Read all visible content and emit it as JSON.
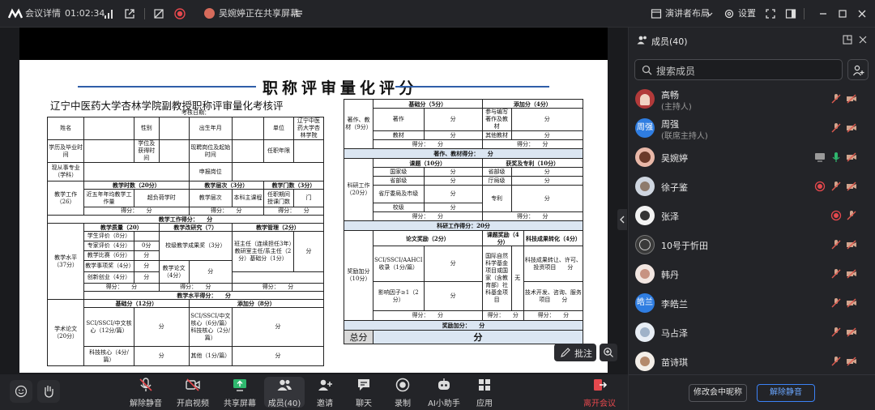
{
  "titlebar": {
    "app_title": "会议详情",
    "timer": "01:02:34",
    "sharing_notice": "吴婉婷正在共享屏幕",
    "layout_label": "演讲者布局",
    "settings_label": "设置"
  },
  "document": {
    "title": "职称评审量化评分",
    "left_caption": "辽宁中医药大学杏林学院副教授职称评审量化考核评",
    "left_subtitle": "考核日期：",
    "total_label": "总分",
    "total_score_label": "分"
  },
  "annotate": {
    "label": "批注"
  },
  "toolbar": {
    "mute": "解除静音",
    "video": "开启视频",
    "share": "共享屏幕",
    "members": "成员(40)",
    "invite": "邀请",
    "chat": "聊天",
    "record": "录制",
    "ai": "AI小助手",
    "apps": "应用",
    "leave": "离开会议"
  },
  "panel": {
    "title": "成员(40)",
    "search_placeholder": "搜索成员",
    "rename_button": "修改会中昵称",
    "unmute_all_button": "解除静音",
    "members": [
      {
        "name": "高畅",
        "role": "(主持人)",
        "avatar": ""
      },
      {
        "name": "周强",
        "role": "(联席主持人)",
        "avatar": "周强"
      },
      {
        "name": "吴婉婷",
        "role": "",
        "avatar": ""
      },
      {
        "name": "徐子鉴",
        "role": "",
        "avatar": ""
      },
      {
        "name": "张泽",
        "role": "",
        "avatar": ""
      },
      {
        "name": "10号于忻田",
        "role": "",
        "avatar": ""
      },
      {
        "name": "韩丹",
        "role": "",
        "avatar": ""
      },
      {
        "name": "李皓兰",
        "role": "",
        "avatar": "皓兰"
      },
      {
        "name": "马占泽",
        "role": "",
        "avatar": ""
      },
      {
        "name": "苗诗琪",
        "role": "",
        "avatar": ""
      }
    ]
  },
  "colors": {
    "accent": "#3b82f6",
    "danger": "#e5484d",
    "panel_bg": "#232428",
    "muted_icon": "#e05a4f"
  }
}
